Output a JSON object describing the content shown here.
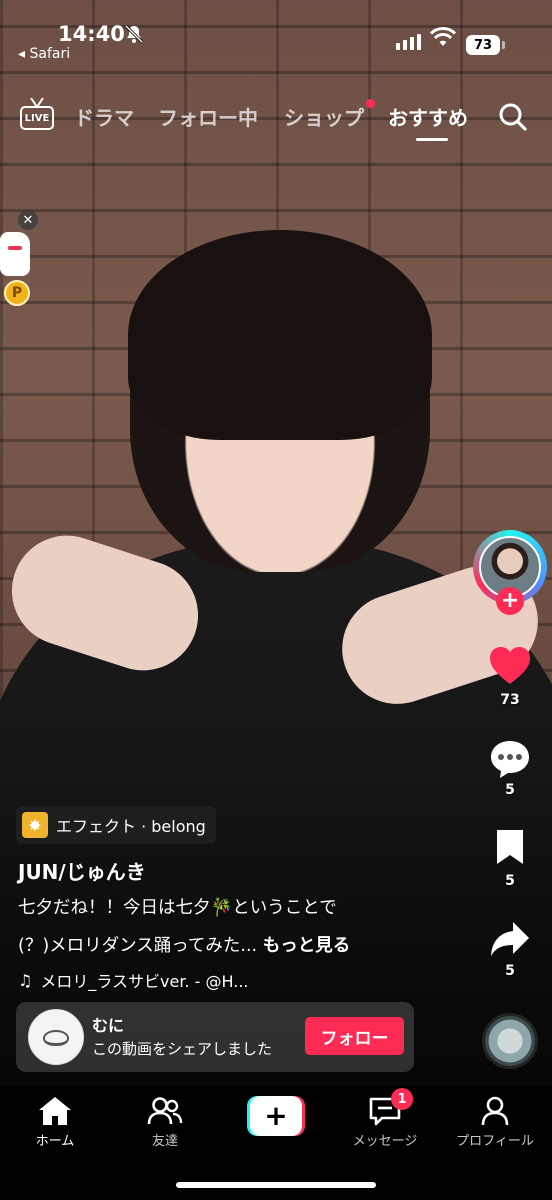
{
  "status_bar": {
    "time": "14:40",
    "back_app": "◂ Safari",
    "battery": "73"
  },
  "top_nav": {
    "live_label": "LIVE",
    "tabs": [
      {
        "label": "ドラマ",
        "active": false
      },
      {
        "label": "フォロー中",
        "active": false
      },
      {
        "label": "ショップ",
        "active": false,
        "has_dot": true
      },
      {
        "label": "おすすめ",
        "active": true
      }
    ]
  },
  "reward_widget": {
    "coin_label": "P"
  },
  "right_rail": {
    "likes": "73",
    "comments": "5",
    "bookmarks": "5",
    "shares": "5"
  },
  "post": {
    "effect": "エフェクト · belong",
    "author": "JUN/じゅんき",
    "description_line1": "七夕だね！！今日は七夕🎋ということで",
    "description_line2": "(？)メロリダンス踊ってみた...",
    "more": "もっと見る",
    "music": "メロリ_ラスサビver. - @H..."
  },
  "share_card": {
    "user_name": "むに",
    "message": "この動画をシェアしました",
    "follow_button": "フォロー"
  },
  "tab_bar": {
    "items": [
      {
        "label": "ホーム",
        "active": true
      },
      {
        "label": "友達",
        "active": false
      },
      {
        "label": "メッセージ",
        "active": false,
        "badge": "1"
      },
      {
        "label": "プロフィール",
        "active": false
      }
    ],
    "create_label": "+"
  },
  "colors": {
    "accent": "#fe2c55",
    "cyan": "#25f4ee"
  }
}
